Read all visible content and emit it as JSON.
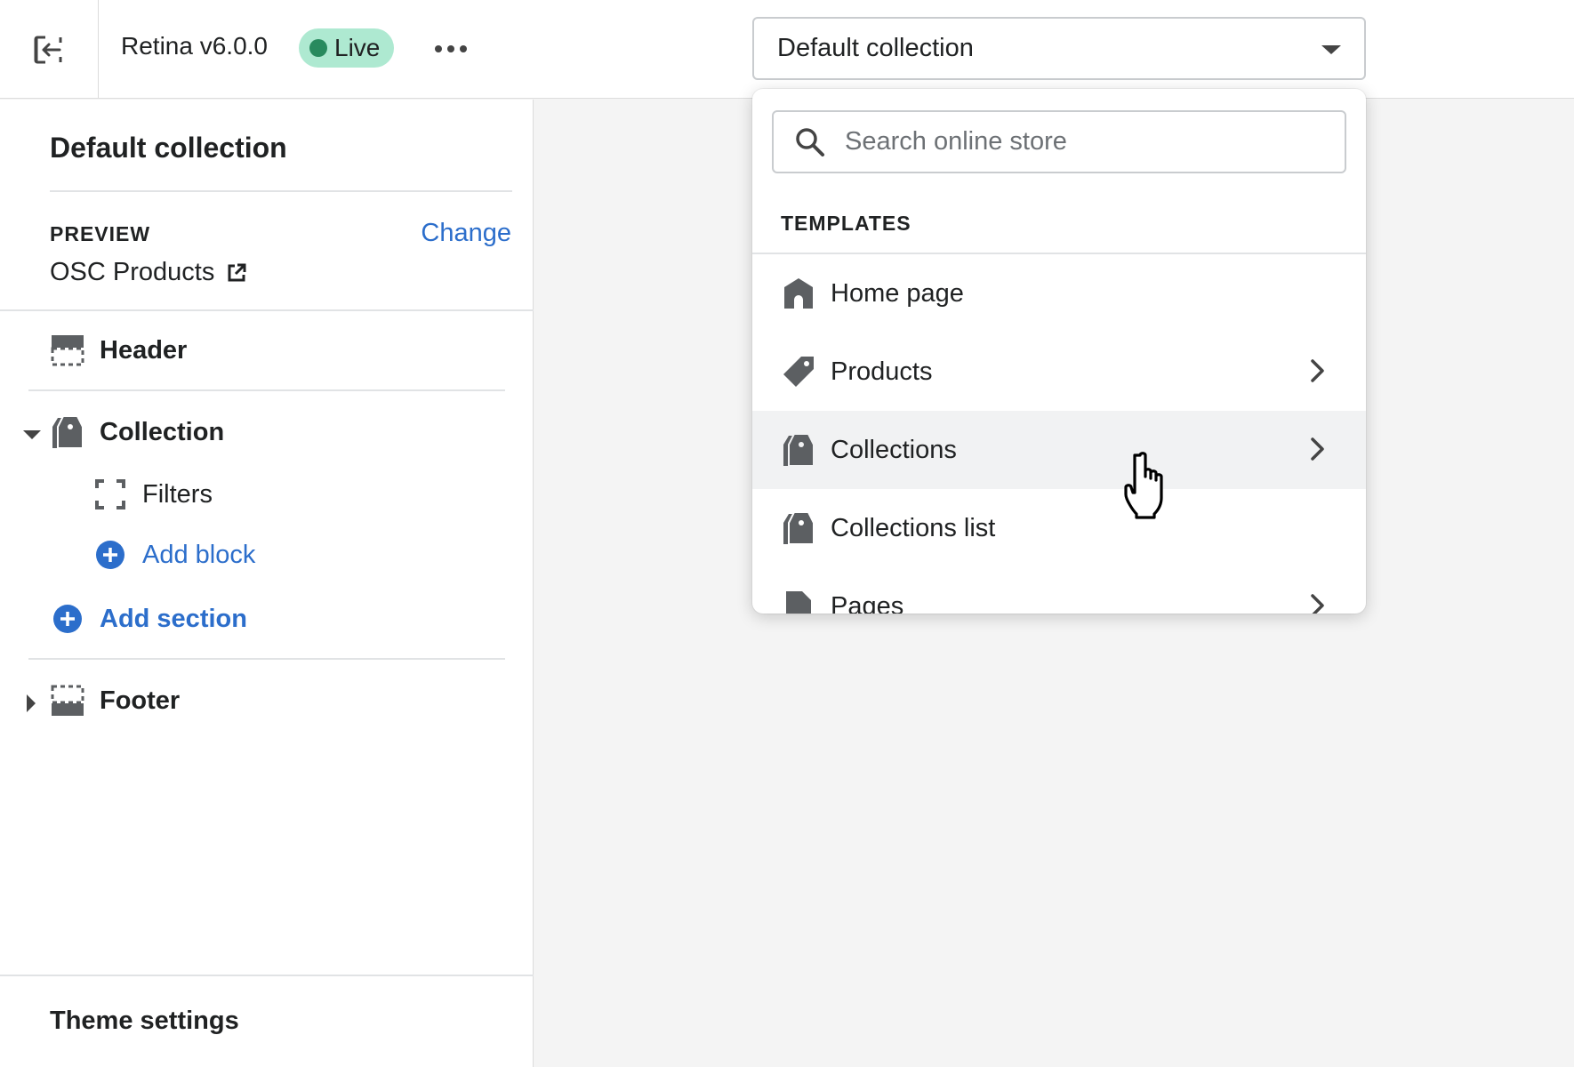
{
  "topbar": {
    "exit_icon": "exit-icon",
    "theme_name": "Retina v6.0.0",
    "status_badge": "Live",
    "more_icon": "more-horizontal-icon",
    "template_selector": "Default collection"
  },
  "sidebar": {
    "title": "Default collection",
    "preview": {
      "label": "PREVIEW",
      "change_link": "Change",
      "value": "OSC Products",
      "external_icon": "external-link-icon"
    },
    "sections": {
      "header": "Header",
      "collection": "Collection",
      "filters": "Filters",
      "add_block": "Add block",
      "add_section": "Add section",
      "footer": "Footer"
    },
    "theme_settings": "Theme settings"
  },
  "dropdown": {
    "search_placeholder": "Search online store",
    "section_label": "TEMPLATES",
    "items": [
      {
        "label": "Home page",
        "icon": "home-icon",
        "has_submenu": false
      },
      {
        "label": "Products",
        "icon": "tag-icon",
        "has_submenu": true
      },
      {
        "label": "Collections",
        "icon": "collections-icon",
        "has_submenu": true
      },
      {
        "label": "Collections list",
        "icon": "collections-icon",
        "has_submenu": false
      },
      {
        "label": "Pages",
        "icon": "page-icon",
        "has_submenu": true
      }
    ]
  },
  "colors": {
    "accent": "#2c6ecb",
    "badge_bg": "#aee9d1",
    "badge_dot": "#288a5e",
    "canvas_bg": "#f4f4f4"
  }
}
